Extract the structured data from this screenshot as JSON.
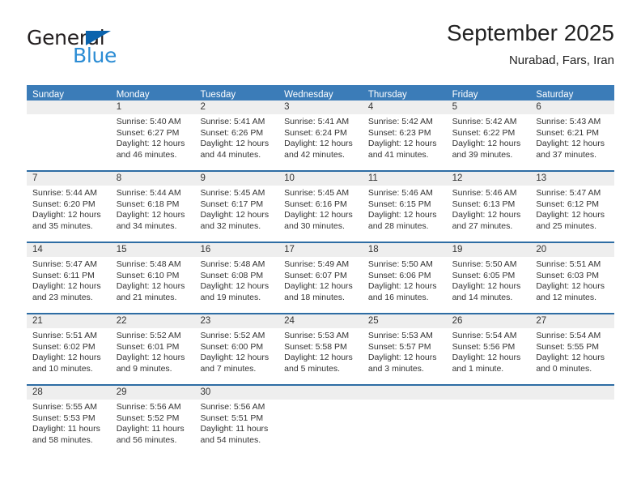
{
  "brand": {
    "general": "General",
    "blue": "Blue",
    "triangle_color": "#0a63ad",
    "blue_color": "#2b8cd4"
  },
  "header": {
    "title": "September 2025",
    "location": "Nurabad, Fars, Iran"
  },
  "theme": {
    "header_bg": "#3b7cb8",
    "row_border": "#2e6da4",
    "day_band_bg": "#eeeeee"
  },
  "weekdays": [
    "Sunday",
    "Monday",
    "Tuesday",
    "Wednesday",
    "Thursday",
    "Friday",
    "Saturday"
  ],
  "weeks": [
    [
      {
        "day": "",
        "sunrise": "",
        "sunset": "",
        "daylight1": "",
        "daylight2": ""
      },
      {
        "day": "1",
        "sunrise": "Sunrise: 5:40 AM",
        "sunset": "Sunset: 6:27 PM",
        "daylight1": "Daylight: 12 hours",
        "daylight2": "and 46 minutes."
      },
      {
        "day": "2",
        "sunrise": "Sunrise: 5:41 AM",
        "sunset": "Sunset: 6:26 PM",
        "daylight1": "Daylight: 12 hours",
        "daylight2": "and 44 minutes."
      },
      {
        "day": "3",
        "sunrise": "Sunrise: 5:41 AM",
        "sunset": "Sunset: 6:24 PM",
        "daylight1": "Daylight: 12 hours",
        "daylight2": "and 42 minutes."
      },
      {
        "day": "4",
        "sunrise": "Sunrise: 5:42 AM",
        "sunset": "Sunset: 6:23 PM",
        "daylight1": "Daylight: 12 hours",
        "daylight2": "and 41 minutes."
      },
      {
        "day": "5",
        "sunrise": "Sunrise: 5:42 AM",
        "sunset": "Sunset: 6:22 PM",
        "daylight1": "Daylight: 12 hours",
        "daylight2": "and 39 minutes."
      },
      {
        "day": "6",
        "sunrise": "Sunrise: 5:43 AM",
        "sunset": "Sunset: 6:21 PM",
        "daylight1": "Daylight: 12 hours",
        "daylight2": "and 37 minutes."
      }
    ],
    [
      {
        "day": "7",
        "sunrise": "Sunrise: 5:44 AM",
        "sunset": "Sunset: 6:20 PM",
        "daylight1": "Daylight: 12 hours",
        "daylight2": "and 35 minutes."
      },
      {
        "day": "8",
        "sunrise": "Sunrise: 5:44 AM",
        "sunset": "Sunset: 6:18 PM",
        "daylight1": "Daylight: 12 hours",
        "daylight2": "and 34 minutes."
      },
      {
        "day": "9",
        "sunrise": "Sunrise: 5:45 AM",
        "sunset": "Sunset: 6:17 PM",
        "daylight1": "Daylight: 12 hours",
        "daylight2": "and 32 minutes."
      },
      {
        "day": "10",
        "sunrise": "Sunrise: 5:45 AM",
        "sunset": "Sunset: 6:16 PM",
        "daylight1": "Daylight: 12 hours",
        "daylight2": "and 30 minutes."
      },
      {
        "day": "11",
        "sunrise": "Sunrise: 5:46 AM",
        "sunset": "Sunset: 6:15 PM",
        "daylight1": "Daylight: 12 hours",
        "daylight2": "and 28 minutes."
      },
      {
        "day": "12",
        "sunrise": "Sunrise: 5:46 AM",
        "sunset": "Sunset: 6:13 PM",
        "daylight1": "Daylight: 12 hours",
        "daylight2": "and 27 minutes."
      },
      {
        "day": "13",
        "sunrise": "Sunrise: 5:47 AM",
        "sunset": "Sunset: 6:12 PM",
        "daylight1": "Daylight: 12 hours",
        "daylight2": "and 25 minutes."
      }
    ],
    [
      {
        "day": "14",
        "sunrise": "Sunrise: 5:47 AM",
        "sunset": "Sunset: 6:11 PM",
        "daylight1": "Daylight: 12 hours",
        "daylight2": "and 23 minutes."
      },
      {
        "day": "15",
        "sunrise": "Sunrise: 5:48 AM",
        "sunset": "Sunset: 6:10 PM",
        "daylight1": "Daylight: 12 hours",
        "daylight2": "and 21 minutes."
      },
      {
        "day": "16",
        "sunrise": "Sunrise: 5:48 AM",
        "sunset": "Sunset: 6:08 PM",
        "daylight1": "Daylight: 12 hours",
        "daylight2": "and 19 minutes."
      },
      {
        "day": "17",
        "sunrise": "Sunrise: 5:49 AM",
        "sunset": "Sunset: 6:07 PM",
        "daylight1": "Daylight: 12 hours",
        "daylight2": "and 18 minutes."
      },
      {
        "day": "18",
        "sunrise": "Sunrise: 5:50 AM",
        "sunset": "Sunset: 6:06 PM",
        "daylight1": "Daylight: 12 hours",
        "daylight2": "and 16 minutes."
      },
      {
        "day": "19",
        "sunrise": "Sunrise: 5:50 AM",
        "sunset": "Sunset: 6:05 PM",
        "daylight1": "Daylight: 12 hours",
        "daylight2": "and 14 minutes."
      },
      {
        "day": "20",
        "sunrise": "Sunrise: 5:51 AM",
        "sunset": "Sunset: 6:03 PM",
        "daylight1": "Daylight: 12 hours",
        "daylight2": "and 12 minutes."
      }
    ],
    [
      {
        "day": "21",
        "sunrise": "Sunrise: 5:51 AM",
        "sunset": "Sunset: 6:02 PM",
        "daylight1": "Daylight: 12 hours",
        "daylight2": "and 10 minutes."
      },
      {
        "day": "22",
        "sunrise": "Sunrise: 5:52 AM",
        "sunset": "Sunset: 6:01 PM",
        "daylight1": "Daylight: 12 hours",
        "daylight2": "and 9 minutes."
      },
      {
        "day": "23",
        "sunrise": "Sunrise: 5:52 AM",
        "sunset": "Sunset: 6:00 PM",
        "daylight1": "Daylight: 12 hours",
        "daylight2": "and 7 minutes."
      },
      {
        "day": "24",
        "sunrise": "Sunrise: 5:53 AM",
        "sunset": "Sunset: 5:58 PM",
        "daylight1": "Daylight: 12 hours",
        "daylight2": "and 5 minutes."
      },
      {
        "day": "25",
        "sunrise": "Sunrise: 5:53 AM",
        "sunset": "Sunset: 5:57 PM",
        "daylight1": "Daylight: 12 hours",
        "daylight2": "and 3 minutes."
      },
      {
        "day": "26",
        "sunrise": "Sunrise: 5:54 AM",
        "sunset": "Sunset: 5:56 PM",
        "daylight1": "Daylight: 12 hours",
        "daylight2": "and 1 minute."
      },
      {
        "day": "27",
        "sunrise": "Sunrise: 5:54 AM",
        "sunset": "Sunset: 5:55 PM",
        "daylight1": "Daylight: 12 hours",
        "daylight2": "and 0 minutes."
      }
    ],
    [
      {
        "day": "28",
        "sunrise": "Sunrise: 5:55 AM",
        "sunset": "Sunset: 5:53 PM",
        "daylight1": "Daylight: 11 hours",
        "daylight2": "and 58 minutes."
      },
      {
        "day": "29",
        "sunrise": "Sunrise: 5:56 AM",
        "sunset": "Sunset: 5:52 PM",
        "daylight1": "Daylight: 11 hours",
        "daylight2": "and 56 minutes."
      },
      {
        "day": "30",
        "sunrise": "Sunrise: 5:56 AM",
        "sunset": "Sunset: 5:51 PM",
        "daylight1": "Daylight: 11 hours",
        "daylight2": "and 54 minutes."
      },
      {
        "day": "",
        "sunrise": "",
        "sunset": "",
        "daylight1": "",
        "daylight2": ""
      },
      {
        "day": "",
        "sunrise": "",
        "sunset": "",
        "daylight1": "",
        "daylight2": ""
      },
      {
        "day": "",
        "sunrise": "",
        "sunset": "",
        "daylight1": "",
        "daylight2": ""
      },
      {
        "day": "",
        "sunrise": "",
        "sunset": "",
        "daylight1": "",
        "daylight2": ""
      }
    ]
  ]
}
